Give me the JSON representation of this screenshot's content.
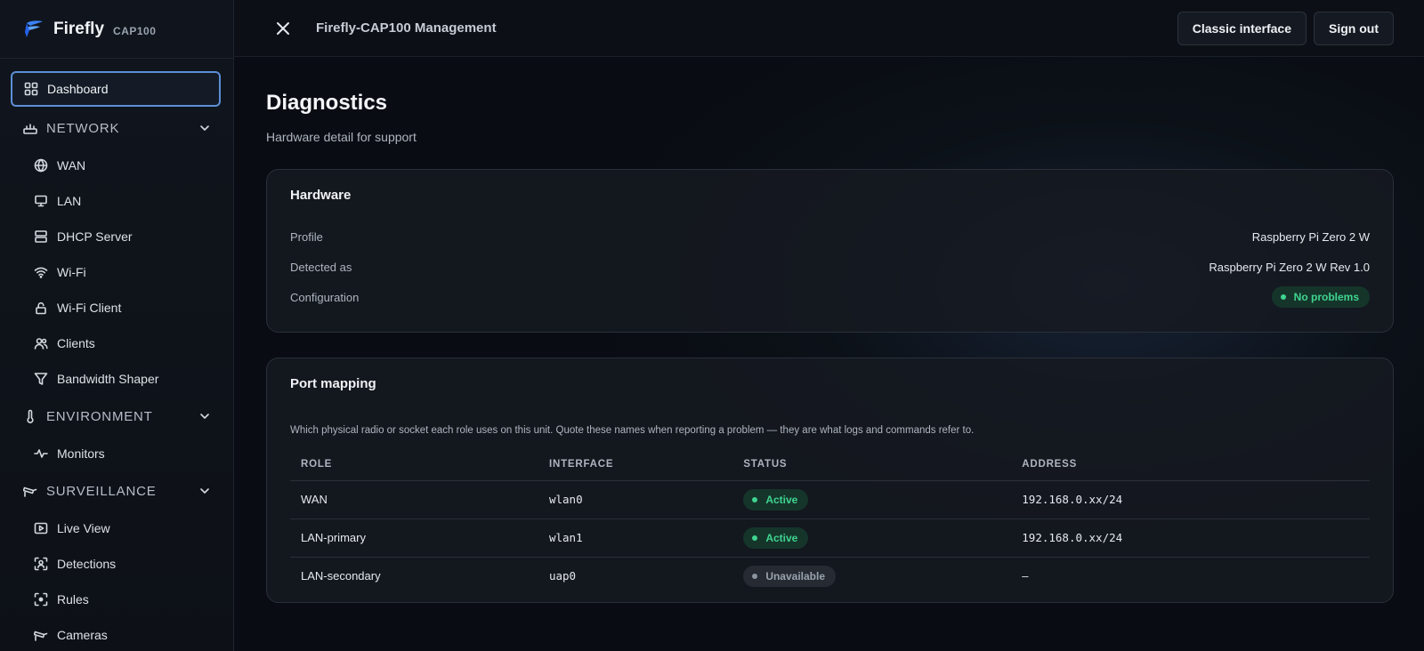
{
  "brand": {
    "name": "Firefly",
    "model": "CAP100"
  },
  "sidebar": {
    "dashboard": {
      "label": "Dashboard",
      "icon": "grid-icon"
    },
    "sections": [
      {
        "label": "NETWORK",
        "icon": "network-icon",
        "items": [
          {
            "label": "WAN",
            "icon": "globe-icon"
          },
          {
            "label": "LAN",
            "icon": "monitor-icon"
          },
          {
            "label": "DHCP Server",
            "icon": "server-icon"
          },
          {
            "label": "Wi-Fi",
            "icon": "wifi-icon"
          },
          {
            "label": "Wi-Fi Client",
            "icon": "wifi-client-icon"
          },
          {
            "label": "Clients",
            "icon": "users-icon"
          },
          {
            "label": "Bandwidth Shaper",
            "icon": "filter-icon"
          }
        ]
      },
      {
        "label": "ENVIRONMENT",
        "icon": "thermometer-icon",
        "items": [
          {
            "label": "Monitors",
            "icon": "activity-icon"
          }
        ]
      },
      {
        "label": "SURVEILLANCE",
        "icon": "cctv-icon",
        "items": [
          {
            "label": "Live View",
            "icon": "play-icon"
          },
          {
            "label": "Detections",
            "icon": "scan-person-icon"
          },
          {
            "label": "Rules",
            "icon": "scan-icon"
          },
          {
            "label": "Cameras",
            "icon": "camera-icon"
          }
        ]
      }
    ]
  },
  "header": {
    "title": "Firefly-CAP100 Management",
    "classic_label": "Classic interface",
    "signout_label": "Sign out"
  },
  "page": {
    "title": "Diagnostics",
    "subtitle": "Hardware detail for support"
  },
  "hardware": {
    "title": "Hardware",
    "rows": [
      {
        "key": "Profile",
        "value": "Raspberry Pi Zero 2 W"
      },
      {
        "key": "Detected as",
        "value": "Raspberry Pi Zero 2 W Rev 1.0"
      },
      {
        "key": "Configuration",
        "value": "No problems",
        "status": "ok"
      }
    ]
  },
  "ports": {
    "title": "Port mapping",
    "description": "Which physical radio or socket each role uses on this unit. Quote these names when reporting a problem — they are what logs and commands refer to.",
    "columns": [
      "ROLE",
      "INTERFACE",
      "STATUS",
      "ADDRESS"
    ],
    "rows": [
      {
        "role": "WAN",
        "interface": "wlan0",
        "status": "Active",
        "status_kind": "ok",
        "address": "192.168.0.xx/24"
      },
      {
        "role": "LAN-primary",
        "interface": "wlan1",
        "status": "Active",
        "status_kind": "ok",
        "address": "192.168.0.xx/24"
      },
      {
        "role": "LAN-secondary",
        "interface": "uap0",
        "status": "Unavailable",
        "status_kind": "na",
        "address": "–"
      }
    ]
  },
  "colors": {
    "accent": "#5b8fd6",
    "ok": "#3fd48f",
    "brand": "#3b82f6"
  }
}
